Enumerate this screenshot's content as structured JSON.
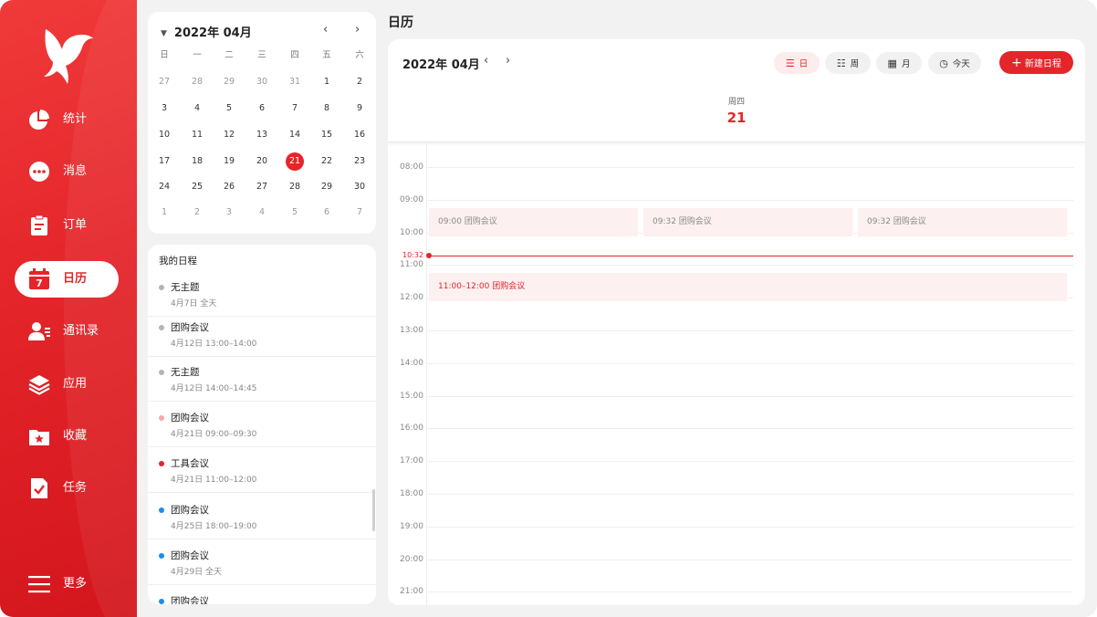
{
  "sidebar": {
    "items": [
      {
        "label": "统计",
        "icon": "pie-chart-icon"
      },
      {
        "label": "消息",
        "icon": "chat-bubble-icon"
      },
      {
        "label": "订单",
        "icon": "clipboard-icon"
      },
      {
        "label": "日历",
        "icon": "calendar-icon",
        "active": true
      },
      {
        "label": "通讯录",
        "icon": "contacts-icon"
      },
      {
        "label": "应用",
        "icon": "layers-icon"
      },
      {
        "label": "收藏",
        "icon": "favorite-folder-icon"
      },
      {
        "label": "任务",
        "icon": "task-check-icon"
      }
    ],
    "more_label": "更多"
  },
  "mini_calendar": {
    "title": "2022年 04月",
    "prev": "‹",
    "next": "›",
    "weekdays": [
      "日",
      "一",
      "二",
      "三",
      "四",
      "五",
      "六"
    ],
    "weeks": [
      [
        "27",
        "28",
        "29",
        "30",
        "31",
        "1",
        "2"
      ],
      [
        "3",
        "4",
        "5",
        "6",
        "7",
        "8",
        "9"
      ],
      [
        "10",
        "11",
        "12",
        "13",
        "14",
        "15",
        "16"
      ],
      [
        "17",
        "18",
        "19",
        "20",
        "21",
        "22",
        "23"
      ],
      [
        "24",
        "25",
        "26",
        "27",
        "28",
        "29",
        "30"
      ],
      [
        "1",
        "2",
        "3",
        "4",
        "5",
        "6",
        "7"
      ]
    ],
    "selected": "21"
  },
  "schedule": {
    "title": "我的日程",
    "items": [
      {
        "title": "无主题",
        "time": "4月7日  全天",
        "color": "#b5b5b5"
      },
      {
        "title": "团购会议",
        "time": "4月12日  13:00–14:00",
        "color": "#b5b5b5"
      },
      {
        "title": "无主题",
        "time": "4月12日  14:00–14:45",
        "color": "#b5b5b5"
      },
      {
        "title": "团购会议",
        "time": "4月21日  09:00–09:30",
        "color": "#f5a9a9"
      },
      {
        "title": "工具会议",
        "time": "4月21日  11:00–12:00",
        "color": "#e4252a"
      },
      {
        "title": "团购会议",
        "time": "4月25日  18:00–19:00",
        "color": "#1a8cf0"
      },
      {
        "title": "团购会议",
        "time": "4月29日  全天",
        "color": "#1a8cf0"
      },
      {
        "title": "团购会议",
        "time": "",
        "color": "#1a8cf0"
      }
    ]
  },
  "page_title": "日历",
  "main": {
    "month": "2022年 04月",
    "prev": "‹",
    "next": "›",
    "views": [
      {
        "label": "日",
        "icon": "list-icon",
        "active": true
      },
      {
        "label": "周",
        "icon": "week-list-icon"
      },
      {
        "label": "月",
        "icon": "grid-icon"
      },
      {
        "label": "今天",
        "icon": "today-icon"
      }
    ],
    "new_label": "新建日程",
    "weekday": "周四",
    "day": "21",
    "hours": [
      "08:00",
      "09:00",
      "10:00",
      "11:00",
      "12:00",
      "13:00",
      "14:00",
      "15:00",
      "16:00",
      "17:00",
      "18:00",
      "19:00",
      "20:00",
      "21:00"
    ],
    "now_label": "10:32",
    "events": [
      {
        "label": "09:00  团购会议"
      },
      {
        "label": "09:32  团购会议"
      },
      {
        "label": "09:32  团购会议"
      },
      {
        "label": "11:00–12:00  团购会议"
      }
    ]
  },
  "colors": {
    "accent": "#e4252a",
    "sidebar": "#e4252a",
    "event_bg": "#fdf0f0"
  }
}
